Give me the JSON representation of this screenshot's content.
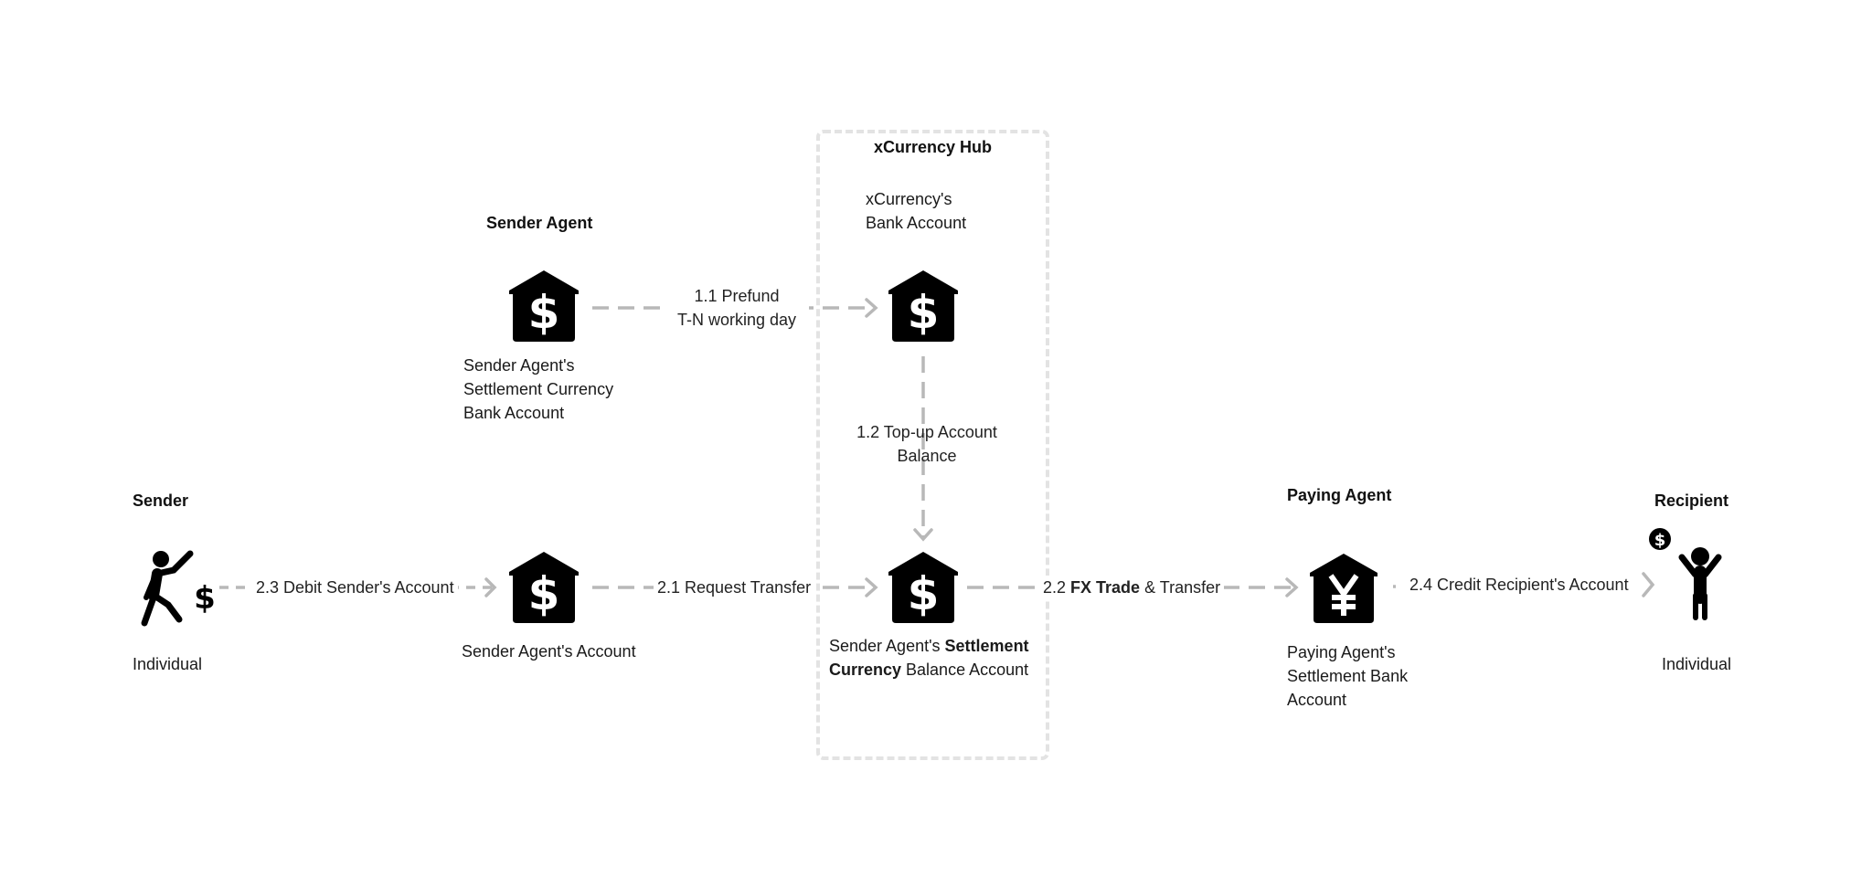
{
  "hub": {
    "title": "xCurrency Hub",
    "bank_account_label": [
      "xCurrency's",
      "Bank Account"
    ]
  },
  "sender_agent": {
    "title": "Sender Agent",
    "settlement_account_label": [
      "Sender Agent's",
      "Settlement Currency",
      "Bank Account"
    ],
    "account_label": "Sender Agent's  Account"
  },
  "balance_account": {
    "line1_normal": "Sender Agent's ",
    "line1_bold": "Settlement",
    "line2_bold": "Currency",
    "line2_normal": " Balance Account"
  },
  "sender": {
    "title": "Sender",
    "subtitle": "Individual"
  },
  "paying_agent": {
    "title": "Paying Agent",
    "account_label": [
      "Paying Agent's",
      "Settlement Bank",
      "Account"
    ]
  },
  "recipient": {
    "title": "Recipient",
    "subtitle": "Individual"
  },
  "flows": {
    "f11": [
      "1.1 Prefund",
      "T-N working day"
    ],
    "f12": [
      "1.2 Top-up Account",
      "Balance"
    ],
    "f21": "2.1 Request Transfer",
    "f22_prefix": "2.2 ",
    "f22_bold": "FX Trade",
    "f22_suffix": " & Transfer",
    "f23": "2.3 Debit Sender's Account",
    "f24": "2.4 Credit Recipient's Account"
  },
  "icons": {
    "bank_dollar": "bank-dollar-icon",
    "bank_yen": "bank-yen-icon",
    "sender_person": "person-sending-money-icon",
    "recipient_person": "person-receiving-money-icon"
  },
  "colors": {
    "connector": "#b8b8b8",
    "hub_border": "#e3e3e3",
    "icon": "#000000"
  }
}
